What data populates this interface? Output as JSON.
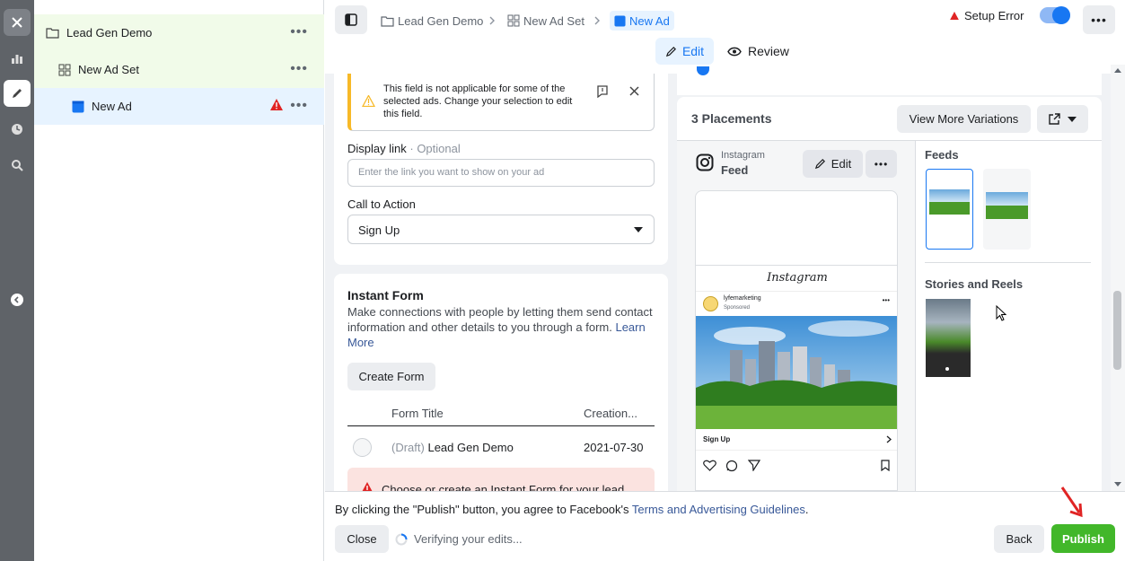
{
  "rail": {
    "icons": [
      "close-icon",
      "chart-icon",
      "pencil-icon",
      "clock-icon",
      "zoom-icon",
      "chevron-left-icon"
    ]
  },
  "tree": {
    "campaign": {
      "label": "Lead Gen Demo"
    },
    "adset": {
      "label": "New Ad Set"
    },
    "ad": {
      "label": "New Ad"
    }
  },
  "topbar": {
    "breadcrumb": [
      "Lead Gen Demo",
      "New Ad Set",
      "New Ad"
    ],
    "setup_error": "Setup Error",
    "edit_tab": "Edit",
    "review_tab": "Review"
  },
  "form": {
    "warning_text": "This field is not applicable for some of the selected ads. Change your selection to edit this field.",
    "display_link_label": "Display link",
    "display_link_optional": "· Optional",
    "display_link_placeholder": "Enter the link you want to show on your ad",
    "cta_label": "Call to Action",
    "cta_value": "Sign Up",
    "instant_form": {
      "title": "Instant Form",
      "description": "Make connections with people by letting them send contact information and other details to you through a form.",
      "learn_more": "Learn More",
      "create_button": "Create Form",
      "col_title": "Form Title",
      "col_created": "Creation...",
      "row_status": "(Draft)",
      "row_name": "Lead Gen Demo",
      "row_date": "2021-07-30",
      "error_text": "Choose or create an Instant Form for your lead"
    }
  },
  "preview": {
    "placements_title": "3 Placements",
    "view_more": "View More Variations",
    "platform": "Instagram",
    "placement": "Feed",
    "edit_label": "Edit",
    "ig_wordmark": "Instagram",
    "ig_account": "lyfemarketing",
    "ig_sponsored": "Sponsored",
    "ig_cta": "Sign Up",
    "feeds_label": "Feeds",
    "stories_label": "Stories and Reels"
  },
  "footer": {
    "agreement_prefix": "By clicking the \"Publish\" button, you agree to Facebook's",
    "agreement_link": "Terms and Advertising Guidelines",
    "agreement_suffix": ".",
    "close": "Close",
    "verifying": "Verifying your edits...",
    "back": "Back",
    "publish": "Publish"
  },
  "colors": {
    "accent": "#1877f2",
    "publish_green": "#42b72a",
    "error_red": "#e02424",
    "warning_yellow": "#f7b928",
    "tree_selected_bg": "#f1fbe9",
    "tree_ad_bg": "#e7f3ff"
  }
}
